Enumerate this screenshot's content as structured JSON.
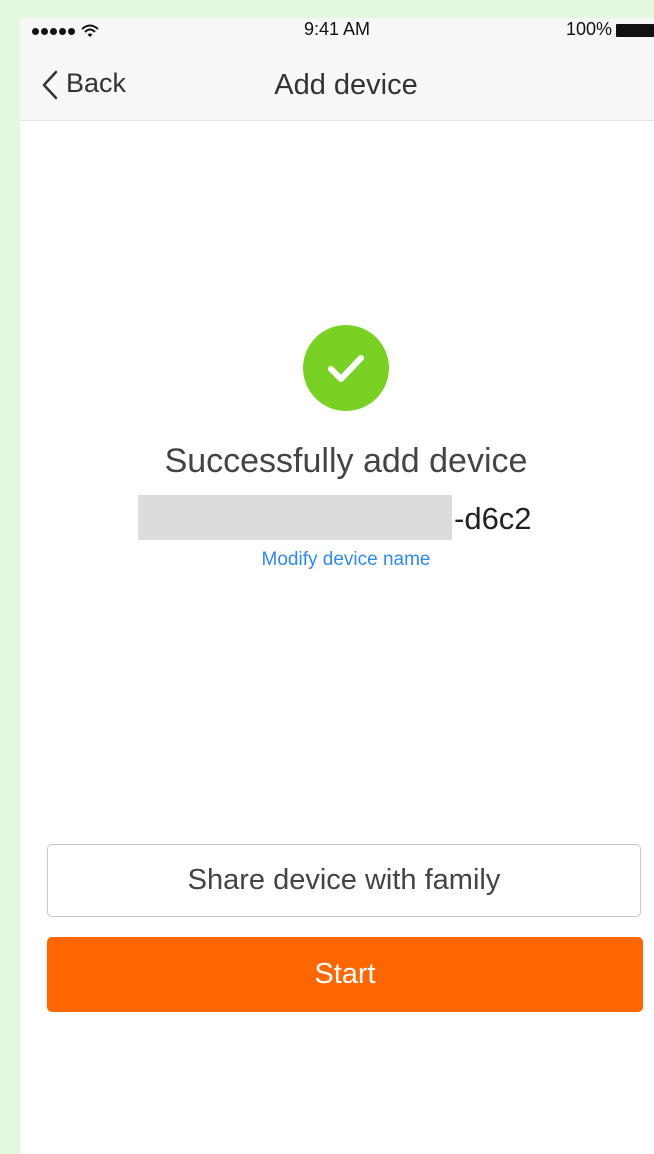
{
  "status_bar": {
    "time": "9:41 AM",
    "battery": "100%",
    "icons": [
      "signal-dots-icon",
      "wifi-icon",
      "battery-icon"
    ]
  },
  "nav": {
    "back_label": "Back",
    "title": "Add device"
  },
  "result": {
    "icon": "checkmark-circle-icon",
    "message": "Successfully add device",
    "device_name_suffix": "-d6c2",
    "modify_link": "Modify device name"
  },
  "actions": {
    "share_label": "Share device with family",
    "start_label": "Start"
  },
  "colors": {
    "accent": "#ff6600",
    "success": "#79d124",
    "link": "#2e8af5"
  }
}
